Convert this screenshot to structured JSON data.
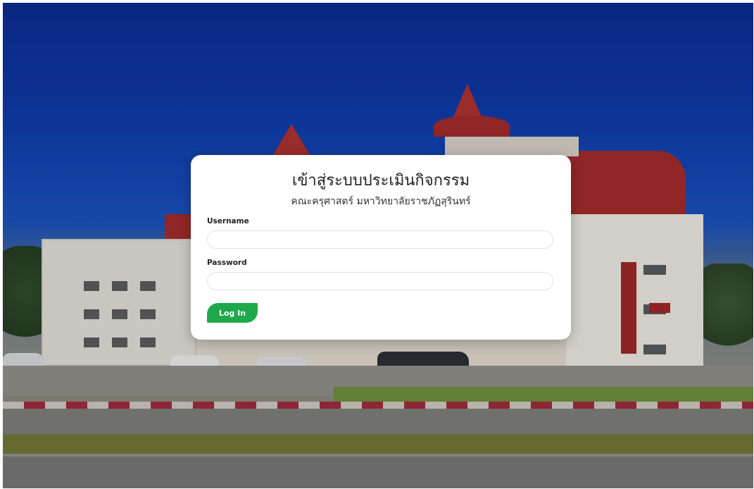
{
  "login": {
    "title": "เข้าสู่ระบบประเมินกิจกรรม",
    "subtitle": "คณะครุศาสตร์ มหาวิทยาลัยราชภัฏสุรินทร์",
    "username_label": "Username",
    "username_value": "",
    "password_label": "Password",
    "password_value": "",
    "submit_label": "Log In"
  },
  "colors": {
    "accent": "#1ea84a",
    "card_bg": "#ffffff",
    "sky": "#0f3aa6",
    "building_red": "#9e2a2a"
  }
}
